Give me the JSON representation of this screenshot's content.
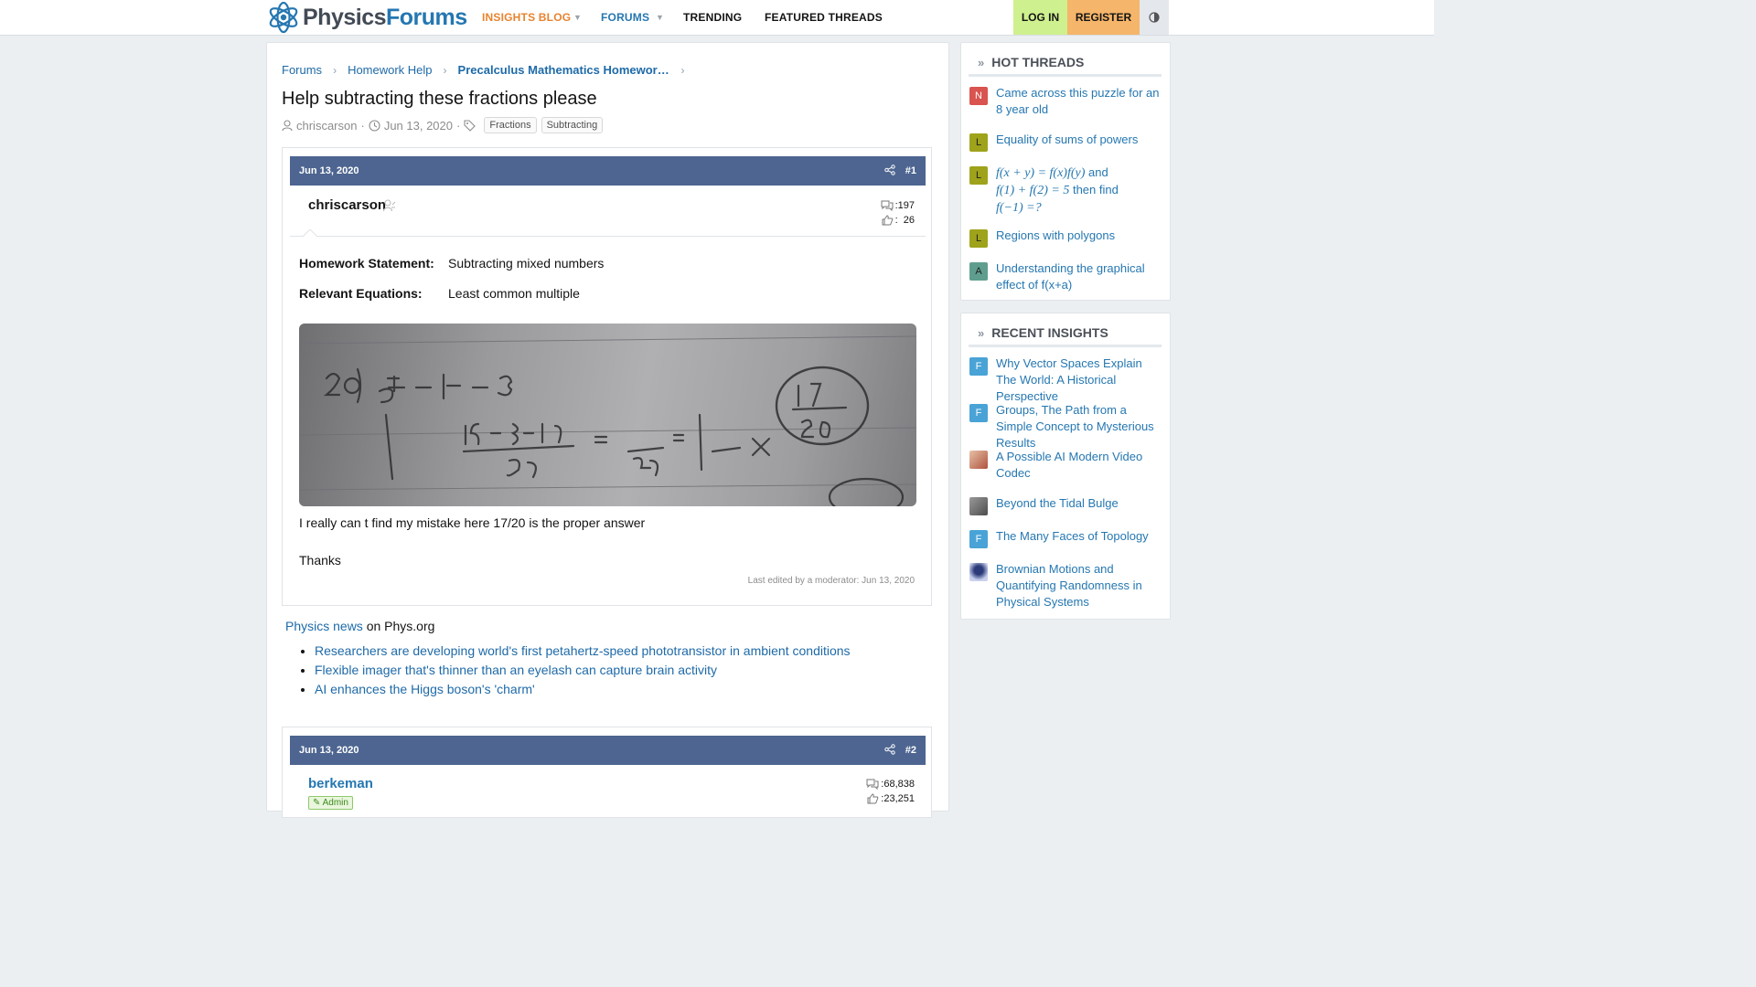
{
  "brand": {
    "name_part1": "Physics",
    "name_part2": "Forums"
  },
  "nav": {
    "insights_blog": "INSIGHTS BLOG",
    "forums": "FORUMS",
    "trending": "TRENDING",
    "featured_threads": "FEATURED THREADS",
    "login": "LOG IN",
    "register": "REGISTER"
  },
  "colors": {
    "accent_orange": "#e8832e",
    "link_blue": "#2577b1",
    "post_header": "#4d6590",
    "login_bg": "#cff08f",
    "register_bg": "#f5b56a"
  },
  "breadcrumb": {
    "item1": "Forums",
    "item2": "Homework Help",
    "item3": "Precalculus Mathematics Homework Help"
  },
  "thread": {
    "title": "Help subtracting these fractions please",
    "author": "chriscarson",
    "date": "Jun 13, 2020",
    "tags": [
      "Fractions",
      "Subtracting"
    ]
  },
  "post1": {
    "date": "Jun 13, 2020",
    "number": "#1",
    "username": "chriscarson",
    "messages": "197",
    "reactions": "26",
    "statement_label": "Homework Statement:",
    "statement_value": "Subtracting mixed numbers",
    "equations_label": "Relevant Equations:",
    "equations_value": "Least common multiple",
    "text1": "I really can t find my mistake here 17/20 is the proper answer",
    "text2": "Thanks",
    "edited": "Last edited by a moderator: Jun 13, 2020"
  },
  "news": {
    "link": "Physics news",
    "suffix": "on Phys.org",
    "items": [
      "Researchers are developing world's first petahertz-speed phototransistor in ambient conditions",
      "Flexible imager that's thinner than an eyelash can capture brain activity",
      "AI enhances the Higgs boson's 'charm'"
    ]
  },
  "post2": {
    "date": "Jun 13, 2020",
    "number": "#2",
    "username": "berkeman",
    "badge": "Admin",
    "messages": "68,838",
    "reactions": "23,251"
  },
  "hot_threads": {
    "title": "HOT THREADS",
    "items": [
      {
        "avatar": "N",
        "avatar_color": "#d9534f",
        "label": "Came across this puzzle for an 8 year old"
      },
      {
        "avatar": "L",
        "avatar_color": "#9ea31b",
        "label": "Equality of sums of powers"
      },
      {
        "avatar": "L",
        "avatar_color": "#9ea31b",
        "math1": "f(x + y) = f(x)f(y)",
        "and": "and",
        "math2": "f(1) + f(2) = 5",
        "then": "then find",
        "math3": "f(−1) =?"
      },
      {
        "avatar": "L",
        "avatar_color": "#9ea31b",
        "label": "Regions with polygons"
      },
      {
        "avatar": "A",
        "avatar_color": "#5f9e8f",
        "label": "Understanding the graphical effect of f(x+a)"
      }
    ]
  },
  "recent_insights": {
    "title": "RECENT INSIGHTS",
    "items": [
      {
        "avatar": "F",
        "avatar_color": "#49a3d6",
        "label": "Why Vector Spaces Explain The World: A Historical Perspective"
      },
      {
        "avatar": "F",
        "avatar_color": "#49a3d6",
        "label": "Groups, The Path from a Simple Concept to Mysterious Results"
      },
      {
        "avatar": "",
        "avatar_color": "#c28c6e",
        "label": "A Possible AI Modern Video Codec"
      },
      {
        "avatar": "",
        "avatar_color": "#7a7a7a",
        "label": "Beyond the Tidal Bulge"
      },
      {
        "avatar": "F",
        "avatar_color": "#49a3d6",
        "label": "The Many Faces of Topology"
      },
      {
        "avatar": "",
        "avatar_color": "#5a6fa8",
        "label": "Brownian Motions and Quantifying Randomness in Physical Systems"
      }
    ]
  }
}
